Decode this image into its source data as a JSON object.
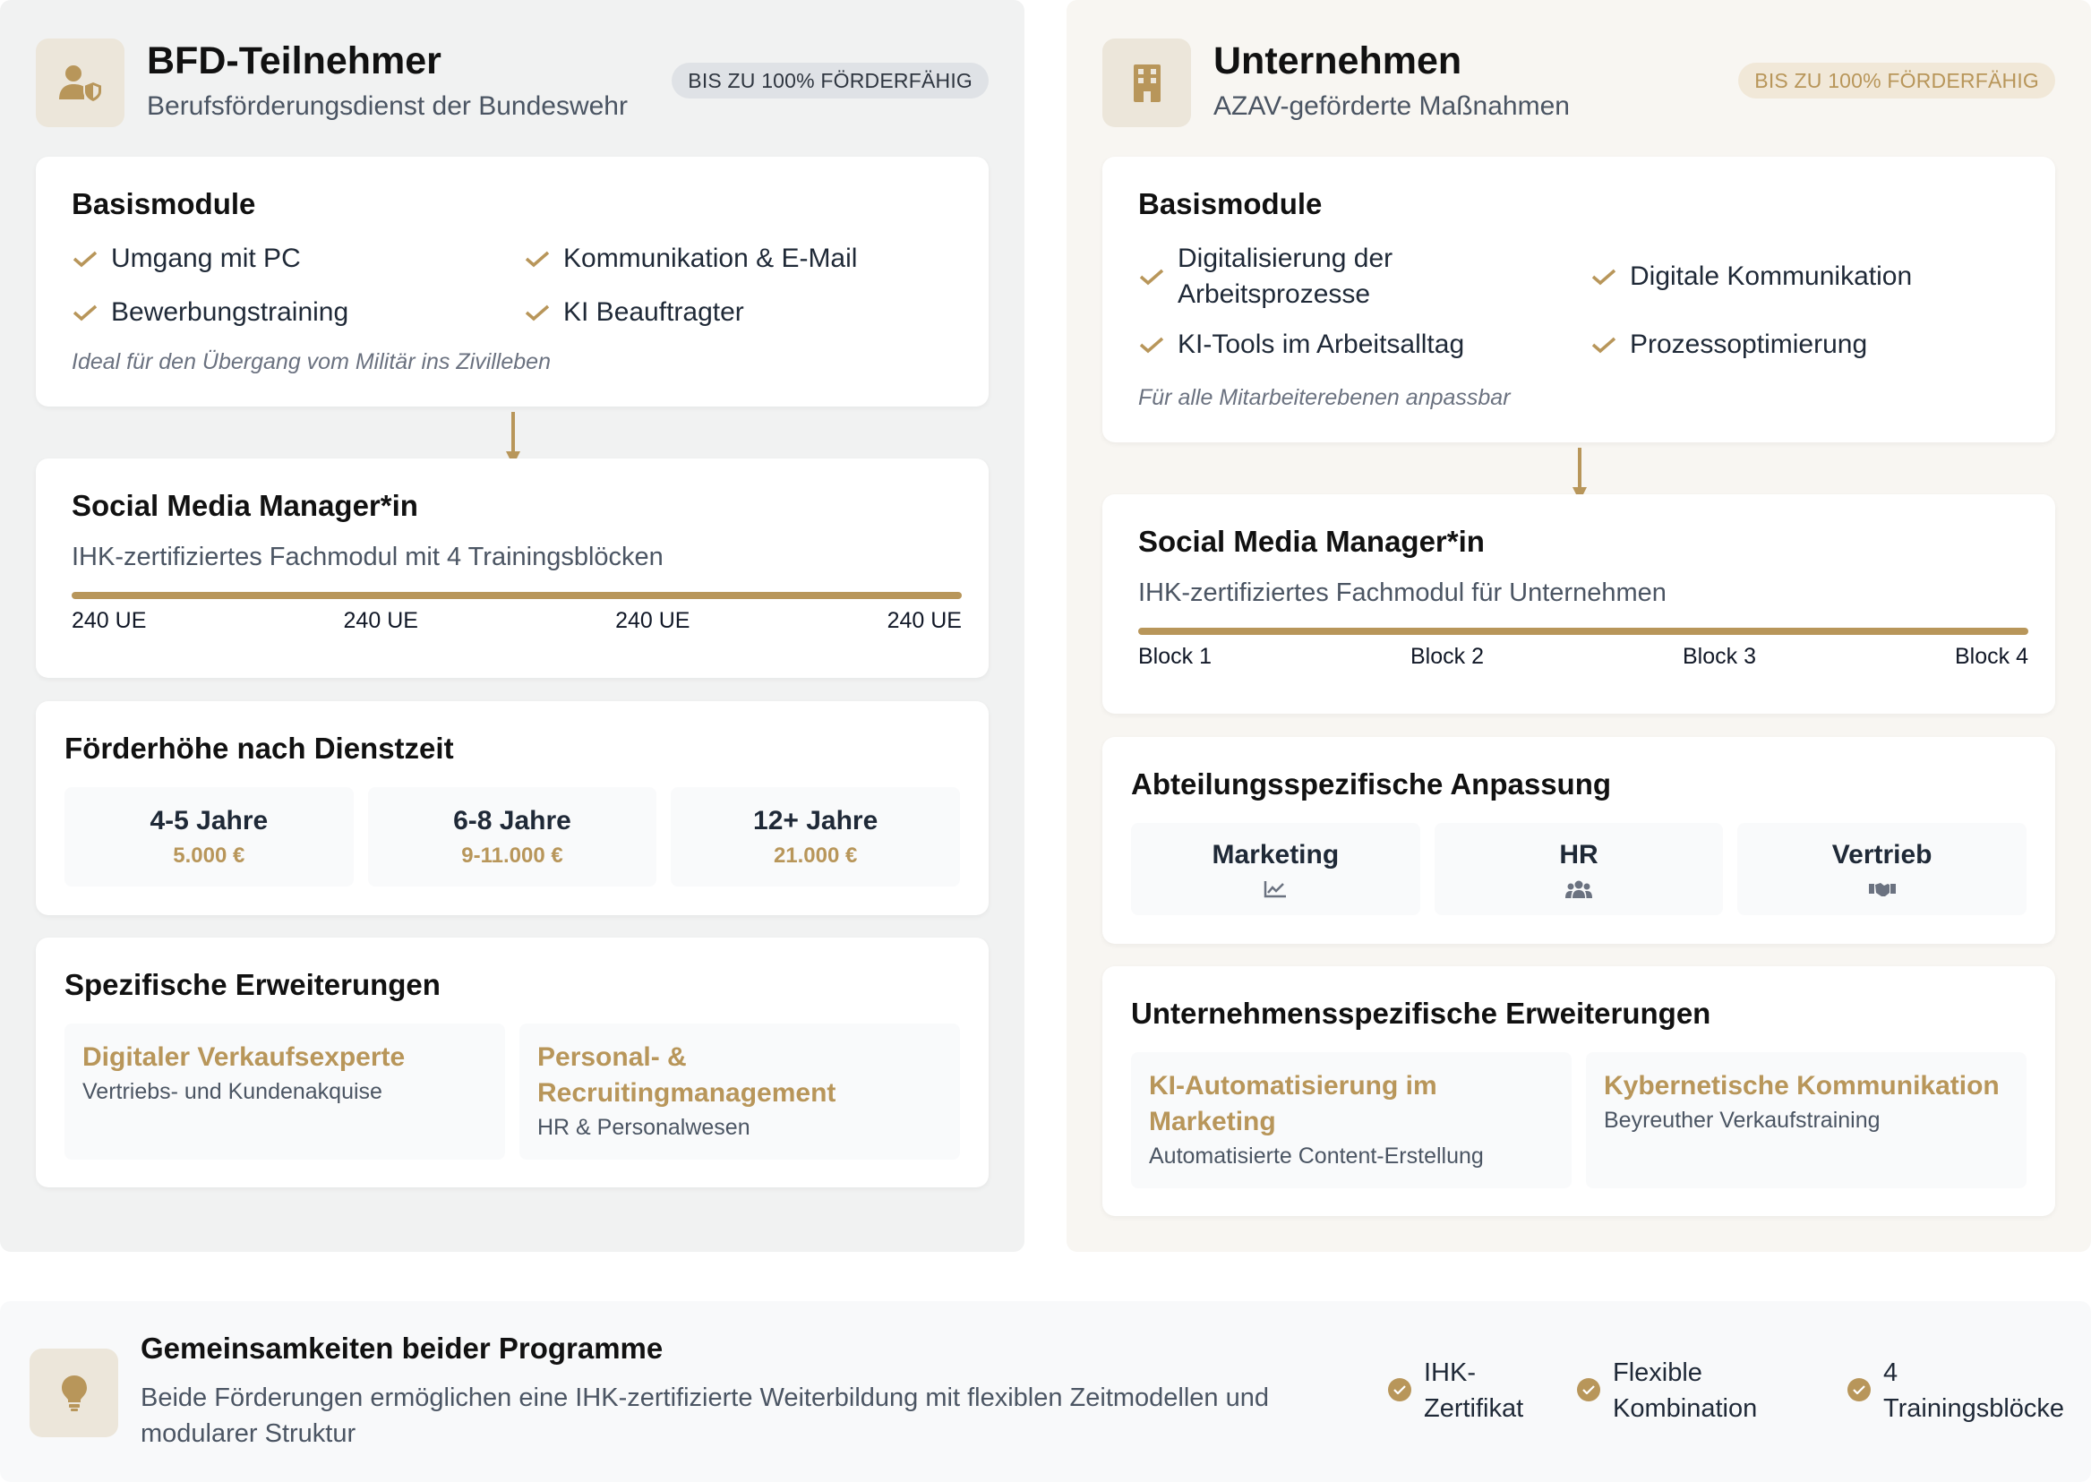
{
  "colors": {
    "accent": "#b8965a",
    "left_bg": "#f1f2f2",
    "right_bg": "#f8f6f2"
  },
  "left": {
    "icon": "user-shield-icon",
    "title": "BFD-Teilnehmer",
    "subtitle": "Berufsförderungsdienst der Bundeswehr",
    "badge": "BIS ZU 100% FÖRDERFÄHIG",
    "basis": {
      "title": "Basismodule",
      "items": [
        "Umgang mit PC",
        "Kommunikation & E-Mail",
        "Bewerbungstraining",
        "KI Beauftragter"
      ],
      "note": "Ideal für den Übergang vom Militär ins Zivilleben"
    },
    "smm": {
      "title": "Social Media Manager*in",
      "desc": "IHK-zertifiziertes Fachmodul mit 4 Trainingsblöcken",
      "labels": [
        "240 UE",
        "240 UE",
        "240 UE",
        "240 UE"
      ]
    },
    "foerder": {
      "title": "Förderhöhe nach Dienstzeit",
      "tiles": [
        {
          "label": "4-5 Jahre",
          "value": "5.000 €"
        },
        {
          "label": "6-8 Jahre",
          "value": "9-11.000 €"
        },
        {
          "label": "12+ Jahre",
          "value": "21.000 €"
        }
      ]
    },
    "ext": {
      "title": "Spezifische Erweiterungen",
      "items": [
        {
          "title": "Digitaler Verkaufsexperte",
          "sub": "Vertriebs- und Kundenakquise"
        },
        {
          "title": "Personal- & Recruitingmanagement",
          "sub": "HR & Personalwesen"
        }
      ]
    }
  },
  "right": {
    "icon": "building-icon",
    "title": "Unternehmen",
    "subtitle": "AZAV-geförderte Maßnahmen",
    "badge": "BIS ZU 100% FÖRDERFÄHIG",
    "basis": {
      "title": "Basismodule",
      "items": [
        "Digitalisierung der Arbeitsprozesse",
        "Digitale Kommunikation",
        "KI-Tools im Arbeitsalltag",
        "Prozessoptimierung"
      ],
      "note": "Für alle Mitarbeiterebenen anpassbar"
    },
    "smm": {
      "title": "Social Media Manager*in",
      "desc": "IHK-zertifiziertes Fachmodul für Unternehmen",
      "labels": [
        "Block 1",
        "Block 2",
        "Block 3",
        "Block 4"
      ]
    },
    "dept": {
      "title": "Abteilungsspezifische Anpassung",
      "tiles": [
        {
          "label": "Marketing",
          "icon": "chart-line-icon"
        },
        {
          "label": "HR",
          "icon": "users-icon"
        },
        {
          "label": "Vertrieb",
          "icon": "handshake-icon"
        }
      ]
    },
    "ext": {
      "title": "Unternehmensspezifische Erweiterungen",
      "items": [
        {
          "title": "KI-Automatisierung im Marketing",
          "sub": "Automatisierte Content-Erstellung"
        },
        {
          "title": "Kybernetische Kommunikation",
          "sub": "Beyreuther Verkaufstraining"
        }
      ]
    }
  },
  "bottom": {
    "icon": "lightbulb-icon",
    "title": "Gemeinsamkeiten beider Programme",
    "text": "Beide Förderungen ermöglichen eine IHK-zertifizierte Weiterbildung mit flexiblen Zeitmodellen und modularer Struktur",
    "features": [
      "IHK-Zertifikat",
      "Flexible Kombination",
      "4 Trainingsblöcke"
    ]
  }
}
